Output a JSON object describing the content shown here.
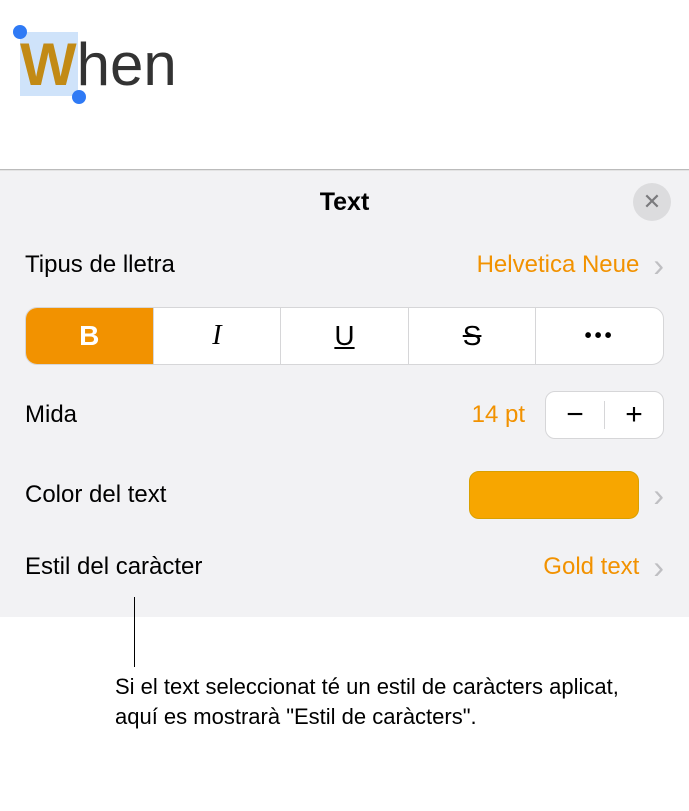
{
  "canvas": {
    "text_gold": "W",
    "text_rest": "hen"
  },
  "panel": {
    "title": "Text",
    "font_row": {
      "label": "Tipus de lletra",
      "value": "Helvetica Neue"
    },
    "style_buttons": {
      "bold": "B",
      "italic": "I",
      "underline": "U",
      "strike": "S",
      "more": "•••"
    },
    "size_row": {
      "label": "Mida",
      "value": "14 pt",
      "minus": "−",
      "plus": "+"
    },
    "color_row": {
      "label": "Color del text",
      "color": "#f7a600"
    },
    "charstyle_row": {
      "label": "Estil del caràcter",
      "value": "Gold text"
    }
  },
  "callout": {
    "text": "Si el text seleccionat té un estil de caràcters aplicat, aquí es mostrarà \"Estil de caràcters\"."
  }
}
